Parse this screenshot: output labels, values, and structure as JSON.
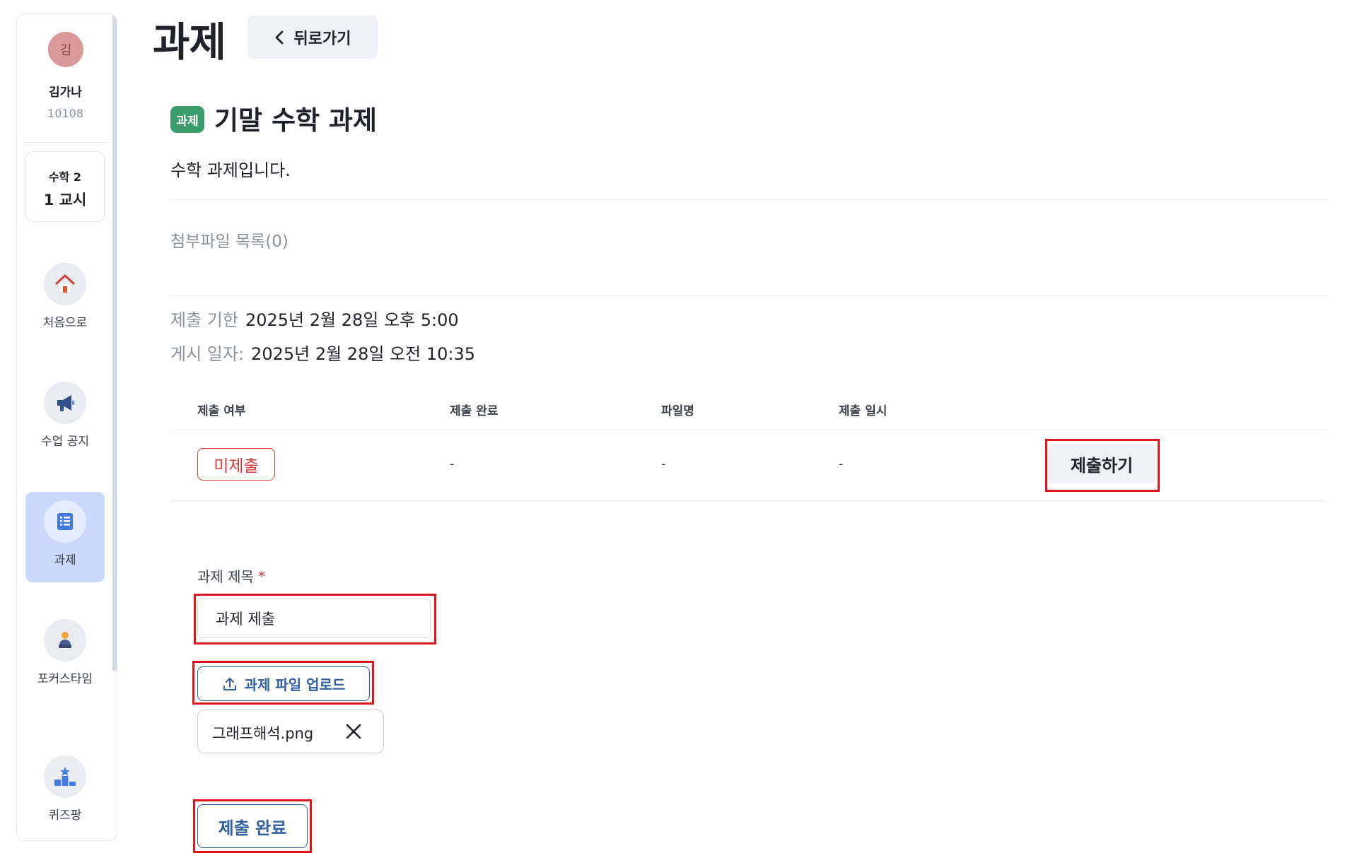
{
  "sidebar": {
    "avatar_initial": "김",
    "user_name": "김가나",
    "user_id": "10108",
    "period": {
      "subject": "수학 2",
      "number": "1 교시"
    },
    "nav": [
      {
        "label": "처음으로",
        "icon": "home-icon"
      },
      {
        "label": "수업 공지",
        "icon": "megaphone-icon"
      },
      {
        "label": "과제",
        "icon": "list-icon",
        "active": true
      },
      {
        "label": "포커스타임",
        "icon": "focus-person-icon"
      },
      {
        "label": "퀴즈팡",
        "icon": "podium-icon"
      }
    ]
  },
  "header": {
    "title": "과제",
    "back_label": "뒤로가기"
  },
  "assignment": {
    "badge": "과제",
    "title": "기말 수학 과제",
    "description": "수학 과제입니다.",
    "attachments_label": "첨부파일 목록(0)",
    "due_label": "제출 기한",
    "due_value": "2025년 2월 28일 오후 5:00",
    "posted_label": "게시 일자:",
    "posted_value": "2025년 2월 28일 오전 10:35"
  },
  "submission_table": {
    "columns": [
      "제출 여부",
      "제출 완료",
      "파일명",
      "제출 일시"
    ],
    "row": {
      "status": "미제출",
      "completed": "-",
      "file_name": "-",
      "submitted_at": "-"
    },
    "submit_label": "제출하기"
  },
  "form": {
    "title_label": "과제 제목",
    "required_mark": "*",
    "title_value": "과제 제출",
    "upload_label": "과제 파일 업로드",
    "file_name": "그래프해석.png",
    "done_label": "제출 완료"
  },
  "colors": {
    "accent": "#2f5fa0",
    "badge_green": "#3b9e6a",
    "status_red": "#d43c3c",
    "highlight_red": "#e0141b",
    "active_nav": "#c9d8fb"
  }
}
